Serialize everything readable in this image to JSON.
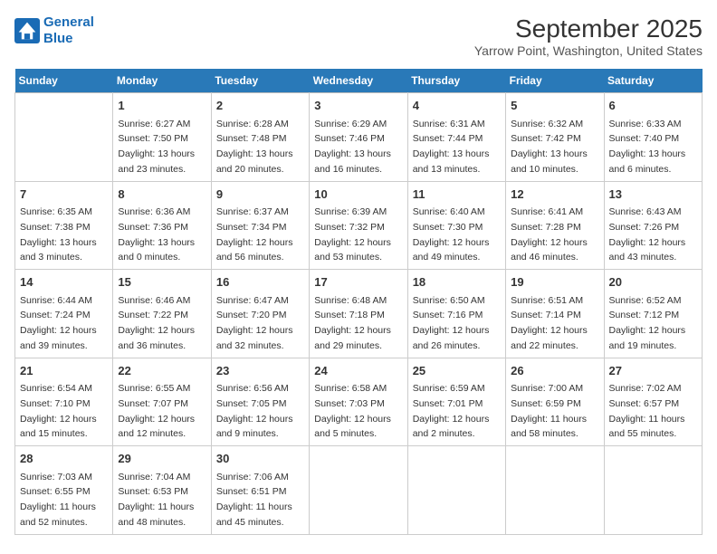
{
  "header": {
    "logo_line1": "General",
    "logo_line2": "Blue",
    "month": "September 2025",
    "location": "Yarrow Point, Washington, United States"
  },
  "weekdays": [
    "Sunday",
    "Monday",
    "Tuesday",
    "Wednesday",
    "Thursday",
    "Friday",
    "Saturday"
  ],
  "weeks": [
    [
      {
        "day": "",
        "sunrise": "",
        "sunset": "",
        "daylight": ""
      },
      {
        "day": "1",
        "sunrise": "Sunrise: 6:27 AM",
        "sunset": "Sunset: 7:50 PM",
        "daylight": "Daylight: 13 hours and 23 minutes."
      },
      {
        "day": "2",
        "sunrise": "Sunrise: 6:28 AM",
        "sunset": "Sunset: 7:48 PM",
        "daylight": "Daylight: 13 hours and 20 minutes."
      },
      {
        "day": "3",
        "sunrise": "Sunrise: 6:29 AM",
        "sunset": "Sunset: 7:46 PM",
        "daylight": "Daylight: 13 hours and 16 minutes."
      },
      {
        "day": "4",
        "sunrise": "Sunrise: 6:31 AM",
        "sunset": "Sunset: 7:44 PM",
        "daylight": "Daylight: 13 hours and 13 minutes."
      },
      {
        "day": "5",
        "sunrise": "Sunrise: 6:32 AM",
        "sunset": "Sunset: 7:42 PM",
        "daylight": "Daylight: 13 hours and 10 minutes."
      },
      {
        "day": "6",
        "sunrise": "Sunrise: 6:33 AM",
        "sunset": "Sunset: 7:40 PM",
        "daylight": "Daylight: 13 hours and 6 minutes."
      }
    ],
    [
      {
        "day": "7",
        "sunrise": "Sunrise: 6:35 AM",
        "sunset": "Sunset: 7:38 PM",
        "daylight": "Daylight: 13 hours and 3 minutes."
      },
      {
        "day": "8",
        "sunrise": "Sunrise: 6:36 AM",
        "sunset": "Sunset: 7:36 PM",
        "daylight": "Daylight: 13 hours and 0 minutes."
      },
      {
        "day": "9",
        "sunrise": "Sunrise: 6:37 AM",
        "sunset": "Sunset: 7:34 PM",
        "daylight": "Daylight: 12 hours and 56 minutes."
      },
      {
        "day": "10",
        "sunrise": "Sunrise: 6:39 AM",
        "sunset": "Sunset: 7:32 PM",
        "daylight": "Daylight: 12 hours and 53 minutes."
      },
      {
        "day": "11",
        "sunrise": "Sunrise: 6:40 AM",
        "sunset": "Sunset: 7:30 PM",
        "daylight": "Daylight: 12 hours and 49 minutes."
      },
      {
        "day": "12",
        "sunrise": "Sunrise: 6:41 AM",
        "sunset": "Sunset: 7:28 PM",
        "daylight": "Daylight: 12 hours and 46 minutes."
      },
      {
        "day": "13",
        "sunrise": "Sunrise: 6:43 AM",
        "sunset": "Sunset: 7:26 PM",
        "daylight": "Daylight: 12 hours and 43 minutes."
      }
    ],
    [
      {
        "day": "14",
        "sunrise": "Sunrise: 6:44 AM",
        "sunset": "Sunset: 7:24 PM",
        "daylight": "Daylight: 12 hours and 39 minutes."
      },
      {
        "day": "15",
        "sunrise": "Sunrise: 6:46 AM",
        "sunset": "Sunset: 7:22 PM",
        "daylight": "Daylight: 12 hours and 36 minutes."
      },
      {
        "day": "16",
        "sunrise": "Sunrise: 6:47 AM",
        "sunset": "Sunset: 7:20 PM",
        "daylight": "Daylight: 12 hours and 32 minutes."
      },
      {
        "day": "17",
        "sunrise": "Sunrise: 6:48 AM",
        "sunset": "Sunset: 7:18 PM",
        "daylight": "Daylight: 12 hours and 29 minutes."
      },
      {
        "day": "18",
        "sunrise": "Sunrise: 6:50 AM",
        "sunset": "Sunset: 7:16 PM",
        "daylight": "Daylight: 12 hours and 26 minutes."
      },
      {
        "day": "19",
        "sunrise": "Sunrise: 6:51 AM",
        "sunset": "Sunset: 7:14 PM",
        "daylight": "Daylight: 12 hours and 22 minutes."
      },
      {
        "day": "20",
        "sunrise": "Sunrise: 6:52 AM",
        "sunset": "Sunset: 7:12 PM",
        "daylight": "Daylight: 12 hours and 19 minutes."
      }
    ],
    [
      {
        "day": "21",
        "sunrise": "Sunrise: 6:54 AM",
        "sunset": "Sunset: 7:10 PM",
        "daylight": "Daylight: 12 hours and 15 minutes."
      },
      {
        "day": "22",
        "sunrise": "Sunrise: 6:55 AM",
        "sunset": "Sunset: 7:07 PM",
        "daylight": "Daylight: 12 hours and 12 minutes."
      },
      {
        "day": "23",
        "sunrise": "Sunrise: 6:56 AM",
        "sunset": "Sunset: 7:05 PM",
        "daylight": "Daylight: 12 hours and 9 minutes."
      },
      {
        "day": "24",
        "sunrise": "Sunrise: 6:58 AM",
        "sunset": "Sunset: 7:03 PM",
        "daylight": "Daylight: 12 hours and 5 minutes."
      },
      {
        "day": "25",
        "sunrise": "Sunrise: 6:59 AM",
        "sunset": "Sunset: 7:01 PM",
        "daylight": "Daylight: 12 hours and 2 minutes."
      },
      {
        "day": "26",
        "sunrise": "Sunrise: 7:00 AM",
        "sunset": "Sunset: 6:59 PM",
        "daylight": "Daylight: 11 hours and 58 minutes."
      },
      {
        "day": "27",
        "sunrise": "Sunrise: 7:02 AM",
        "sunset": "Sunset: 6:57 PM",
        "daylight": "Daylight: 11 hours and 55 minutes."
      }
    ],
    [
      {
        "day": "28",
        "sunrise": "Sunrise: 7:03 AM",
        "sunset": "Sunset: 6:55 PM",
        "daylight": "Daylight: 11 hours and 52 minutes."
      },
      {
        "day": "29",
        "sunrise": "Sunrise: 7:04 AM",
        "sunset": "Sunset: 6:53 PM",
        "daylight": "Daylight: 11 hours and 48 minutes."
      },
      {
        "day": "30",
        "sunrise": "Sunrise: 7:06 AM",
        "sunset": "Sunset: 6:51 PM",
        "daylight": "Daylight: 11 hours and 45 minutes."
      },
      {
        "day": "",
        "sunrise": "",
        "sunset": "",
        "daylight": ""
      },
      {
        "day": "",
        "sunrise": "",
        "sunset": "",
        "daylight": ""
      },
      {
        "day": "",
        "sunrise": "",
        "sunset": "",
        "daylight": ""
      },
      {
        "day": "",
        "sunrise": "",
        "sunset": "",
        "daylight": ""
      }
    ]
  ]
}
